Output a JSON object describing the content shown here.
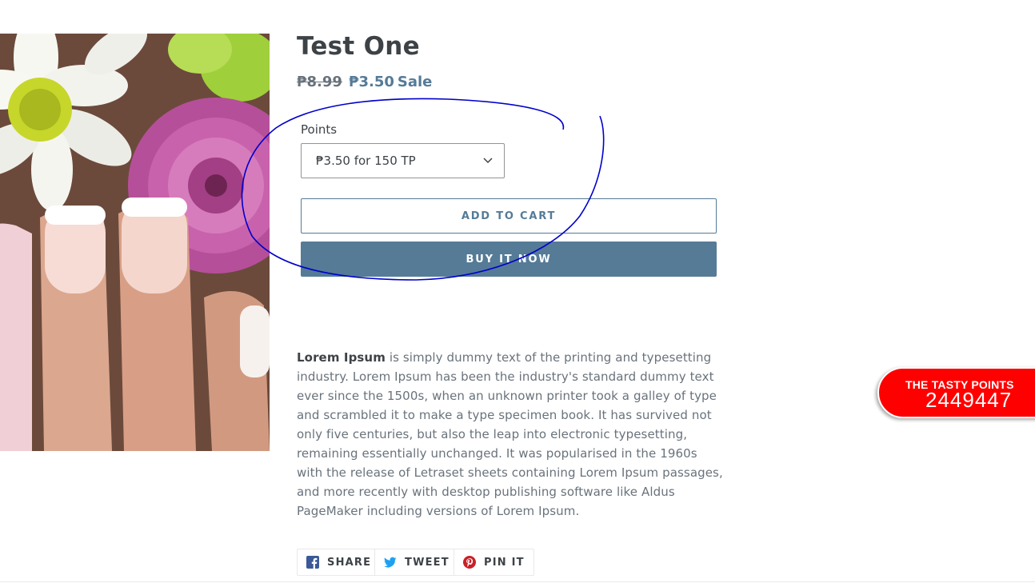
{
  "product": {
    "title": "Test One",
    "price_original": "₱8.99",
    "price_sale": "₱3.50",
    "sale_label": "Sale",
    "image_icon": "flower-nails-photo"
  },
  "points": {
    "label": "Points",
    "selected": "₱3.50 for 150 TP"
  },
  "buttons": {
    "add_to_cart": "ADD TO CART",
    "buy_now": "BUY IT NOW"
  },
  "description": {
    "lead": "Lorem Ipsum",
    "body": " is simply dummy text of the printing and typesetting industry. Lorem Ipsum has been the industry's standard dummy text ever since the 1500s, when an unknown printer took a galley of type and scrambled it to make a type specimen book. It has survived not only five centuries, but also the leap into electronic typesetting, remaining essentially unchanged. It was popularised in the 1960s with the release of Letraset sheets containing Lorem Ipsum passages, and more recently with desktop publishing software like Aldus PageMaker including versions of Lorem Ipsum."
  },
  "share": {
    "facebook": "SHARE",
    "twitter": "TWEET",
    "pinterest": "PIN IT"
  },
  "tasty_points": {
    "label": "THE TASTY POINTS",
    "value": "2449447"
  },
  "colors": {
    "accent": "#557b97",
    "widget": "#ff0000",
    "annotation": "#0000cc"
  }
}
